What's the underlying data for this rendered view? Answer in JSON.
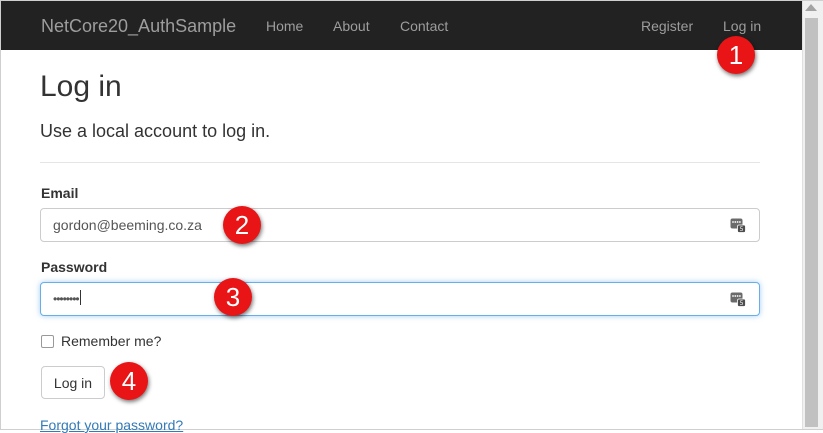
{
  "navbar": {
    "brand": "NetCore20_AuthSample",
    "links": [
      "Home",
      "About",
      "Contact"
    ],
    "register": "Register",
    "login": "Log in"
  },
  "page": {
    "title": "Log in",
    "subtitle": "Use a local account to log in."
  },
  "form": {
    "email_label": "Email",
    "email_value": "gordon@beeming.co.za",
    "password_label": "Password",
    "password_mask": "••••••••",
    "remember_label": "Remember me?",
    "remember_checked": false,
    "submit_label": "Log in",
    "forgot_link": "Forgot your password?"
  },
  "annotations": [
    "1",
    "2",
    "3",
    "4"
  ],
  "icons": {
    "field_icon": "password-manager-icon"
  },
  "colors": {
    "navbar_bg": "#222222",
    "nav_text": "#9d9d9d",
    "marker_red": "#e81416",
    "link_blue": "#337ab7",
    "focus_border": "#66afe9"
  }
}
